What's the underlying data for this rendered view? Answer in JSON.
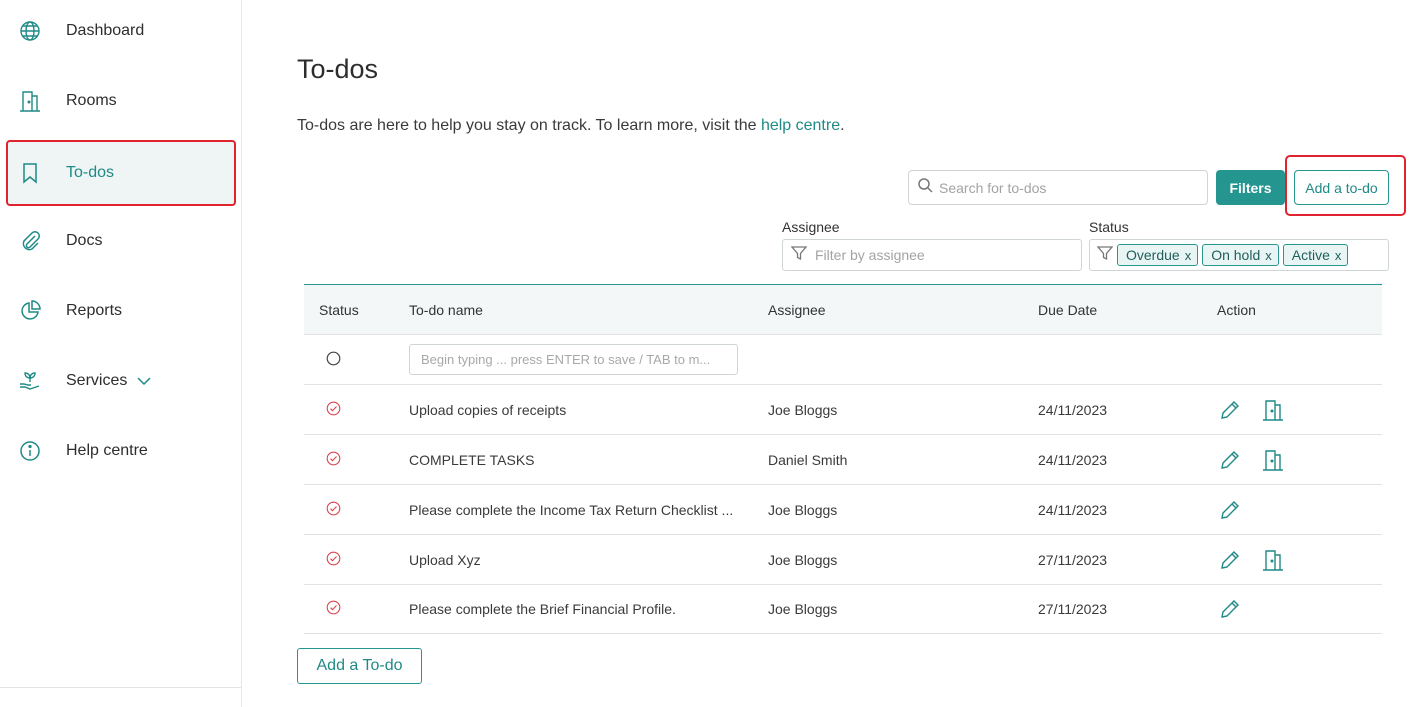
{
  "sidebar": {
    "items": [
      {
        "label": "Dashboard",
        "icon": "globe-icon"
      },
      {
        "label": "Rooms",
        "icon": "building-icon"
      },
      {
        "label": "To-dos",
        "icon": "bookmark-icon",
        "active": true
      },
      {
        "label": "Docs",
        "icon": "paperclip-icon"
      },
      {
        "label": "Reports",
        "icon": "pie-chart-icon"
      },
      {
        "label": "Services",
        "icon": "plant-hand-icon",
        "has_chevron": true
      },
      {
        "label": "Help centre",
        "icon": "info-icon"
      }
    ]
  },
  "main": {
    "title": "To-dos",
    "intro_text": "To-dos are here to help you stay on track. To learn more, visit the ",
    "intro_link": "help centre",
    "intro_end": "."
  },
  "toolbar": {
    "search_placeholder": "Search for to-dos",
    "filters_label": "Filters",
    "add_label": "Add a to-do"
  },
  "filters": {
    "assignee_label": "Assignee",
    "assignee_placeholder": "Filter by assignee",
    "status_label": "Status",
    "status_chips": [
      "Overdue",
      "On hold",
      "Active"
    ],
    "chip_remove": "x"
  },
  "table": {
    "headers": {
      "status": "Status",
      "name": "To-do name",
      "assignee": "Assignee",
      "due": "Due Date",
      "action": "Action"
    },
    "new_row_placeholder": "Begin typing ... press ENTER to save / TAB to m...",
    "rows": [
      {
        "name": "Upload copies of receipts",
        "assignee": "Joe Bloggs",
        "due": "24/11/2023",
        "has_room": true
      },
      {
        "name": "COMPLETE TASKS",
        "assignee": "Daniel Smith",
        "due": "24/11/2023",
        "has_room": true
      },
      {
        "name": "Please complete the Income Tax Return Checklist ...",
        "assignee": "Joe Bloggs",
        "due": "24/11/2023",
        "has_room": false
      },
      {
        "name": "Upload Xyz",
        "assignee": "Joe Bloggs",
        "due": "27/11/2023",
        "has_room": true
      },
      {
        "name": "Please complete the Brief Financial Profile.",
        "assignee": "Joe Bloggs",
        "due": "27/11/2023",
        "has_room": false
      }
    ]
  },
  "footer": {
    "add_label": "Add a To-do"
  },
  "colors": {
    "accent": "#25958f",
    "highlight": "#e0232f",
    "status_icon": "#d9434e"
  }
}
